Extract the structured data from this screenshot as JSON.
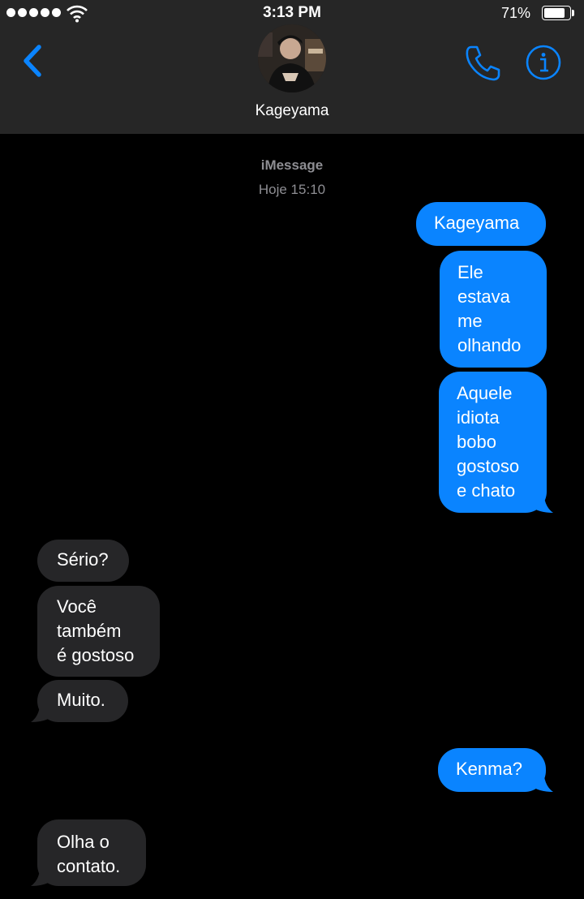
{
  "status_bar": {
    "signal_bars": 5,
    "time": "3:13 PM",
    "battery_percent": "71%",
    "battery_level": 0.71
  },
  "header": {
    "back_icon": "chevron-left-icon",
    "contact_name": "Kageyama",
    "call_icon": "phone-icon",
    "info_icon": "info-icon"
  },
  "conversation": {
    "service": "iMessage",
    "timestamp": "Hoje 15:10",
    "messages": [
      {
        "sender": "me",
        "text": "Kageyama"
      },
      {
        "sender": "me",
        "text": "Ele\nestava\nme\nolhando"
      },
      {
        "sender": "me",
        "text": "Aquele\nidiota\nbobo\ngostoso\ne chato"
      },
      {
        "sender": "contact",
        "text": "Sério?"
      },
      {
        "sender": "contact",
        "text": "Você\ntambém\né gostoso"
      },
      {
        "sender": "contact",
        "text": "Muito."
      },
      {
        "sender": "me",
        "text": "Kenma?"
      },
      {
        "sender": "contact",
        "text": "Olha o\ncontato."
      }
    ]
  },
  "colors": {
    "outgoing_bubble": "#0a84ff",
    "incoming_bubble": "#262628",
    "header_background": "#262626",
    "accent": "#0a84ff"
  }
}
